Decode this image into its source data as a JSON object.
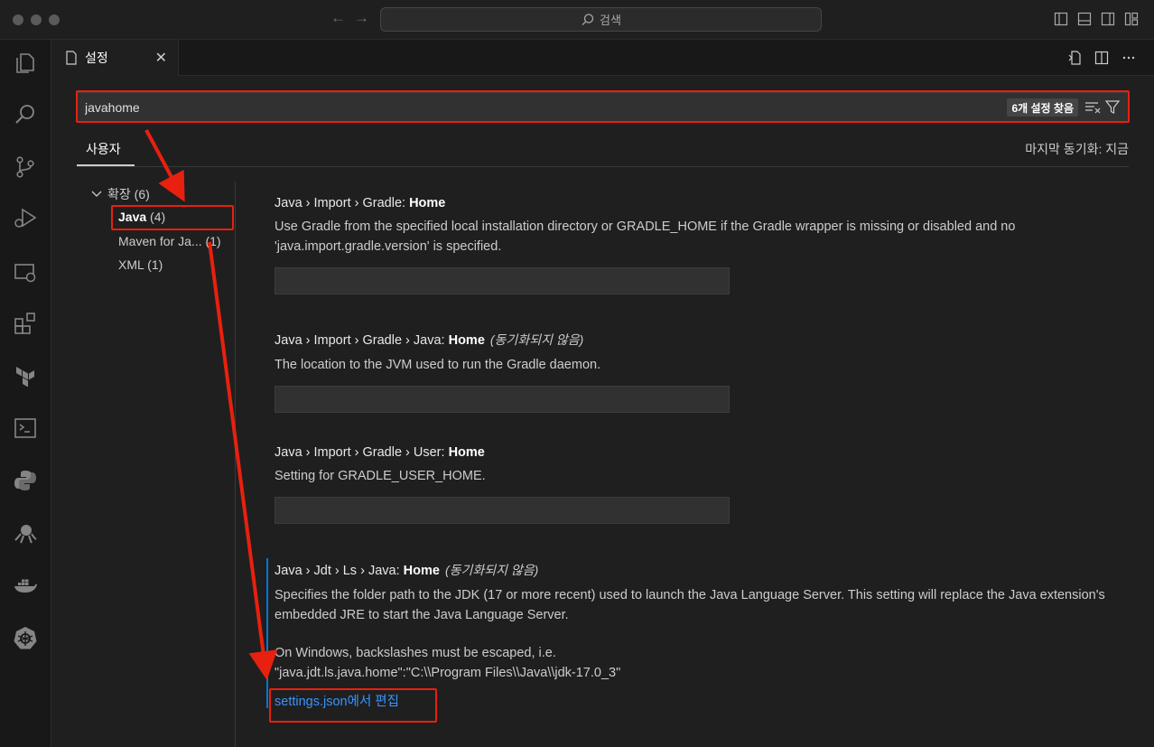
{
  "titlebar": {
    "search_label": "검색",
    "icons": [
      "back-arrow-icon",
      "forward-arrow-icon",
      "search-icon",
      "toggle-primary-sidebar-icon",
      "toggle-panel-icon",
      "toggle-secondary-sidebar-icon",
      "customize-layout-icon"
    ]
  },
  "activity_bar": {
    "icons": [
      "explorer-icon",
      "search-icon",
      "source-control-icon",
      "run-debug-icon",
      "remote-explorer-icon",
      "extensions-icon",
      "terraform-icon",
      "terminal-icon",
      "python-icon",
      "octopus-icon",
      "docker-icon",
      "kubernetes-icon"
    ]
  },
  "tab": {
    "label": "설정",
    "close_glyph": "✕"
  },
  "search": {
    "value": "javahome",
    "result_count": "6개 설정 찾음"
  },
  "scope": {
    "user_tab": "사용자",
    "last_sync": "마지막 동기화: 지금"
  },
  "toc": {
    "extensions_label": "확장",
    "extensions_count": "(6)",
    "items": [
      {
        "label": "Java",
        "count": "(4)"
      },
      {
        "label": "Maven for Ja...",
        "count": "(1)"
      },
      {
        "label": "XML",
        "count": "(1)"
      }
    ]
  },
  "settings": [
    {
      "path": "Java › Import › Gradle: ",
      "name": "Home",
      "unsynced": "",
      "description": "Use Gradle from the specified local installation directory or GRADLE_HOME if the Gradle wrapper is missing or disabled and no 'java.import.gradle.version' is specified."
    },
    {
      "path": "Java › Import › Gradle › Java: ",
      "name": "Home",
      "unsynced": "(동기화되지 않음)",
      "description": "The location to the JVM used to run the Gradle daemon."
    },
    {
      "path": "Java › Import › Gradle › User: ",
      "name": "Home",
      "unsynced": "",
      "description": "Setting for GRADLE_USER_HOME."
    },
    {
      "path": "Java › Jdt › Ls › Java: ",
      "name": "Home",
      "unsynced": "(동기화되지 않음)",
      "description": "Specifies the folder path to the JDK (17 or more recent) used to launch the Java Language Server. This setting will replace the Java extension's embedded JRE to start the Java Language Server.",
      "description_2": "On Windows, backslashes must be escaped, i.e.",
      "description_3": "\"java.jdt.ls.java.home\":\"C:\\\\Program Files\\\\Java\\\\jdk-17.0_3\"",
      "edit_link": "settings.json에서 편집"
    }
  ],
  "colors": {
    "accent": "#0078d4",
    "link": "#3794ff",
    "annotation": "#e8200f"
  }
}
